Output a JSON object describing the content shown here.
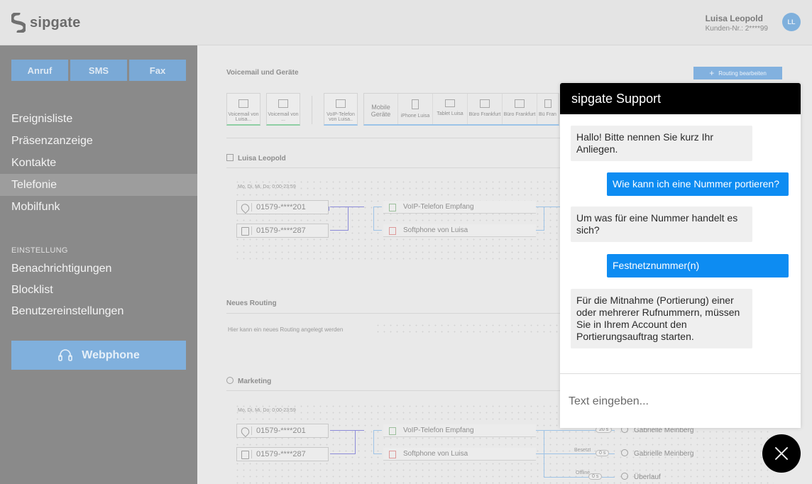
{
  "header": {
    "brand": "sipgate",
    "user_name": "Luisa Leopold",
    "customer_no": "Kunden-Nr.: 2****99",
    "avatar_initials": "LL"
  },
  "sidebar": {
    "quick_actions": [
      "Anruf",
      "SMS",
      "Fax"
    ],
    "items": [
      "Ereignisliste",
      "Präsenzanzeige",
      "Kontakte",
      "Telefonie",
      "Mobilfunk"
    ],
    "active_item": "Telefonie",
    "section_label": "EINSTELLUNG",
    "settings_items": [
      "Benachrichtigungen",
      "Blocklist",
      "Benutzereinstellungen"
    ],
    "webphone_label": "Webphone"
  },
  "main": {
    "voicemail_title": "Voicemail und Geräte",
    "routing_button": "Routing bearbeiten",
    "devices": [
      {
        "label": "Voicemail von Luisa..."
      },
      {
        "label": "Voicemail von ..."
      },
      {
        "label": "VoIP-Telefon von Luisa.."
      }
    ],
    "mobile_group_label": "Mobile Geräte",
    "mobile_devices": [
      "iPhone Luisa",
      "Tablet Luisa",
      "Büro Frankfurt",
      "Büro Frankfurt",
      "Bü Fran"
    ],
    "luisa_section": "Luisa Leopold",
    "schedule_days": "Mo, Di, Mi, Do:",
    "schedule_time": "0:00-23:59",
    "numbers": [
      "01579-****201",
      "01579-****287"
    ],
    "routes": [
      "VoIP-Telefon Empfang",
      "Softphone von Luisa"
    ],
    "new_routing_title": "Neues Routing",
    "new_routing_hint": "Hier kann ein neues Routing angelegt werden",
    "marketing_section": "Marketing",
    "marketing_people": [
      "Gabrielle Meinberg",
      "Gabrielle Meinberg",
      "Überlauf"
    ],
    "marketing_tags": [
      "Besetzt",
      "Offline"
    ],
    "marketing_pills": [
      "20 s",
      "0 s",
      "0 s"
    ]
  },
  "chat": {
    "title": "sipgate Support",
    "messages": [
      {
        "from": "agent",
        "text": "Hallo! Bitte nennen Sie kurz Ihr Anliegen."
      },
      {
        "from": "user",
        "text": "Wie kann ich eine Nummer portieren?"
      },
      {
        "from": "agent",
        "text": "Um was für eine Nummer handelt es sich?"
      },
      {
        "from": "user",
        "text": "Festnetznummer(n)"
      },
      {
        "from": "agent",
        "text": "Für die Mitnahme (Portierung) einer oder mehrerer Rufnummern, müssen Sie in Ihrem Account den Portierungsauftrag starten."
      }
    ],
    "input_placeholder": "Text eingeben..."
  },
  "colors": {
    "accent_blue": "#0d8cf2",
    "chat_header": "#000000",
    "overlay_sidebar": "#8a8a8a"
  }
}
